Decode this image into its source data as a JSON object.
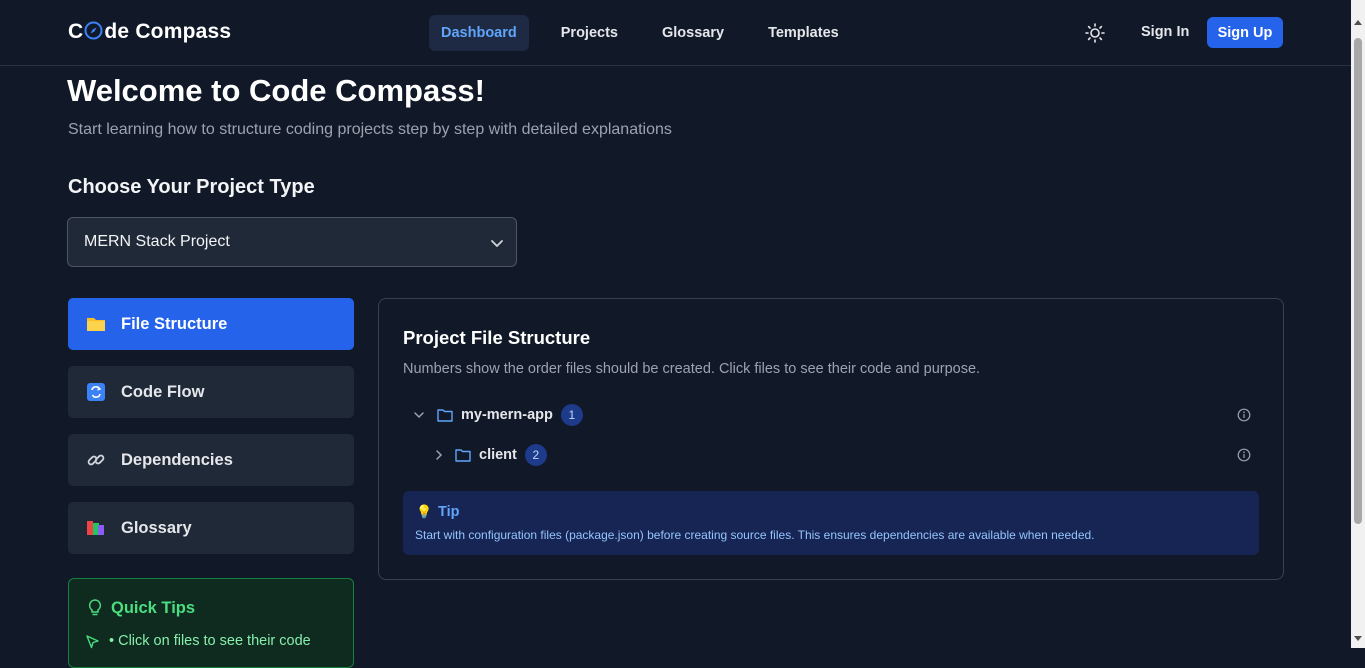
{
  "header": {
    "logo": {
      "part1": "C",
      "part2": "de Compass"
    },
    "nav": [
      {
        "label": "Dashboard",
        "active": true
      },
      {
        "label": "Projects",
        "active": false
      },
      {
        "label": "Glossary",
        "active": false
      },
      {
        "label": "Templates",
        "active": false
      }
    ],
    "theme_icon": "sun-icon",
    "sign_in": "Sign In",
    "sign_up": "Sign Up"
  },
  "main": {
    "title": "Welcome to Code Compass!",
    "subtitle": "Start learning how to structure coding projects step by step with detailed explanations",
    "project_type_heading": "Choose Your Project Type",
    "project_select": {
      "value": "MERN Stack Project"
    }
  },
  "sidebar": {
    "items": [
      {
        "label": "File Structure",
        "icon": "folder-icon",
        "active": true
      },
      {
        "label": "Code Flow",
        "icon": "refresh-icon",
        "active": false
      },
      {
        "label": "Dependencies",
        "icon": "link-icon",
        "active": false
      },
      {
        "label": "Glossary",
        "icon": "books-icon",
        "active": false
      }
    ],
    "quick_tips": {
      "title": "Quick Tips",
      "items": [
        "• Click on files to see their code"
      ]
    }
  },
  "panel": {
    "title": "Project File Structure",
    "description": "Numbers show the order files should be created. Click files to see their code and purpose.",
    "tree": [
      {
        "name": "my-mern-app",
        "order": "1",
        "expanded": true
      },
      {
        "name": "client",
        "order": "2",
        "expanded": false
      }
    ],
    "tip": {
      "title": "Tip",
      "text": "Start with configuration files (package.json) before creating source files. This ensures dependencies are available when needed."
    }
  },
  "colors": {
    "background": "#111827",
    "accent": "#2563eb",
    "link_active": "#60a5fa",
    "tips_green": "#4ade80"
  }
}
